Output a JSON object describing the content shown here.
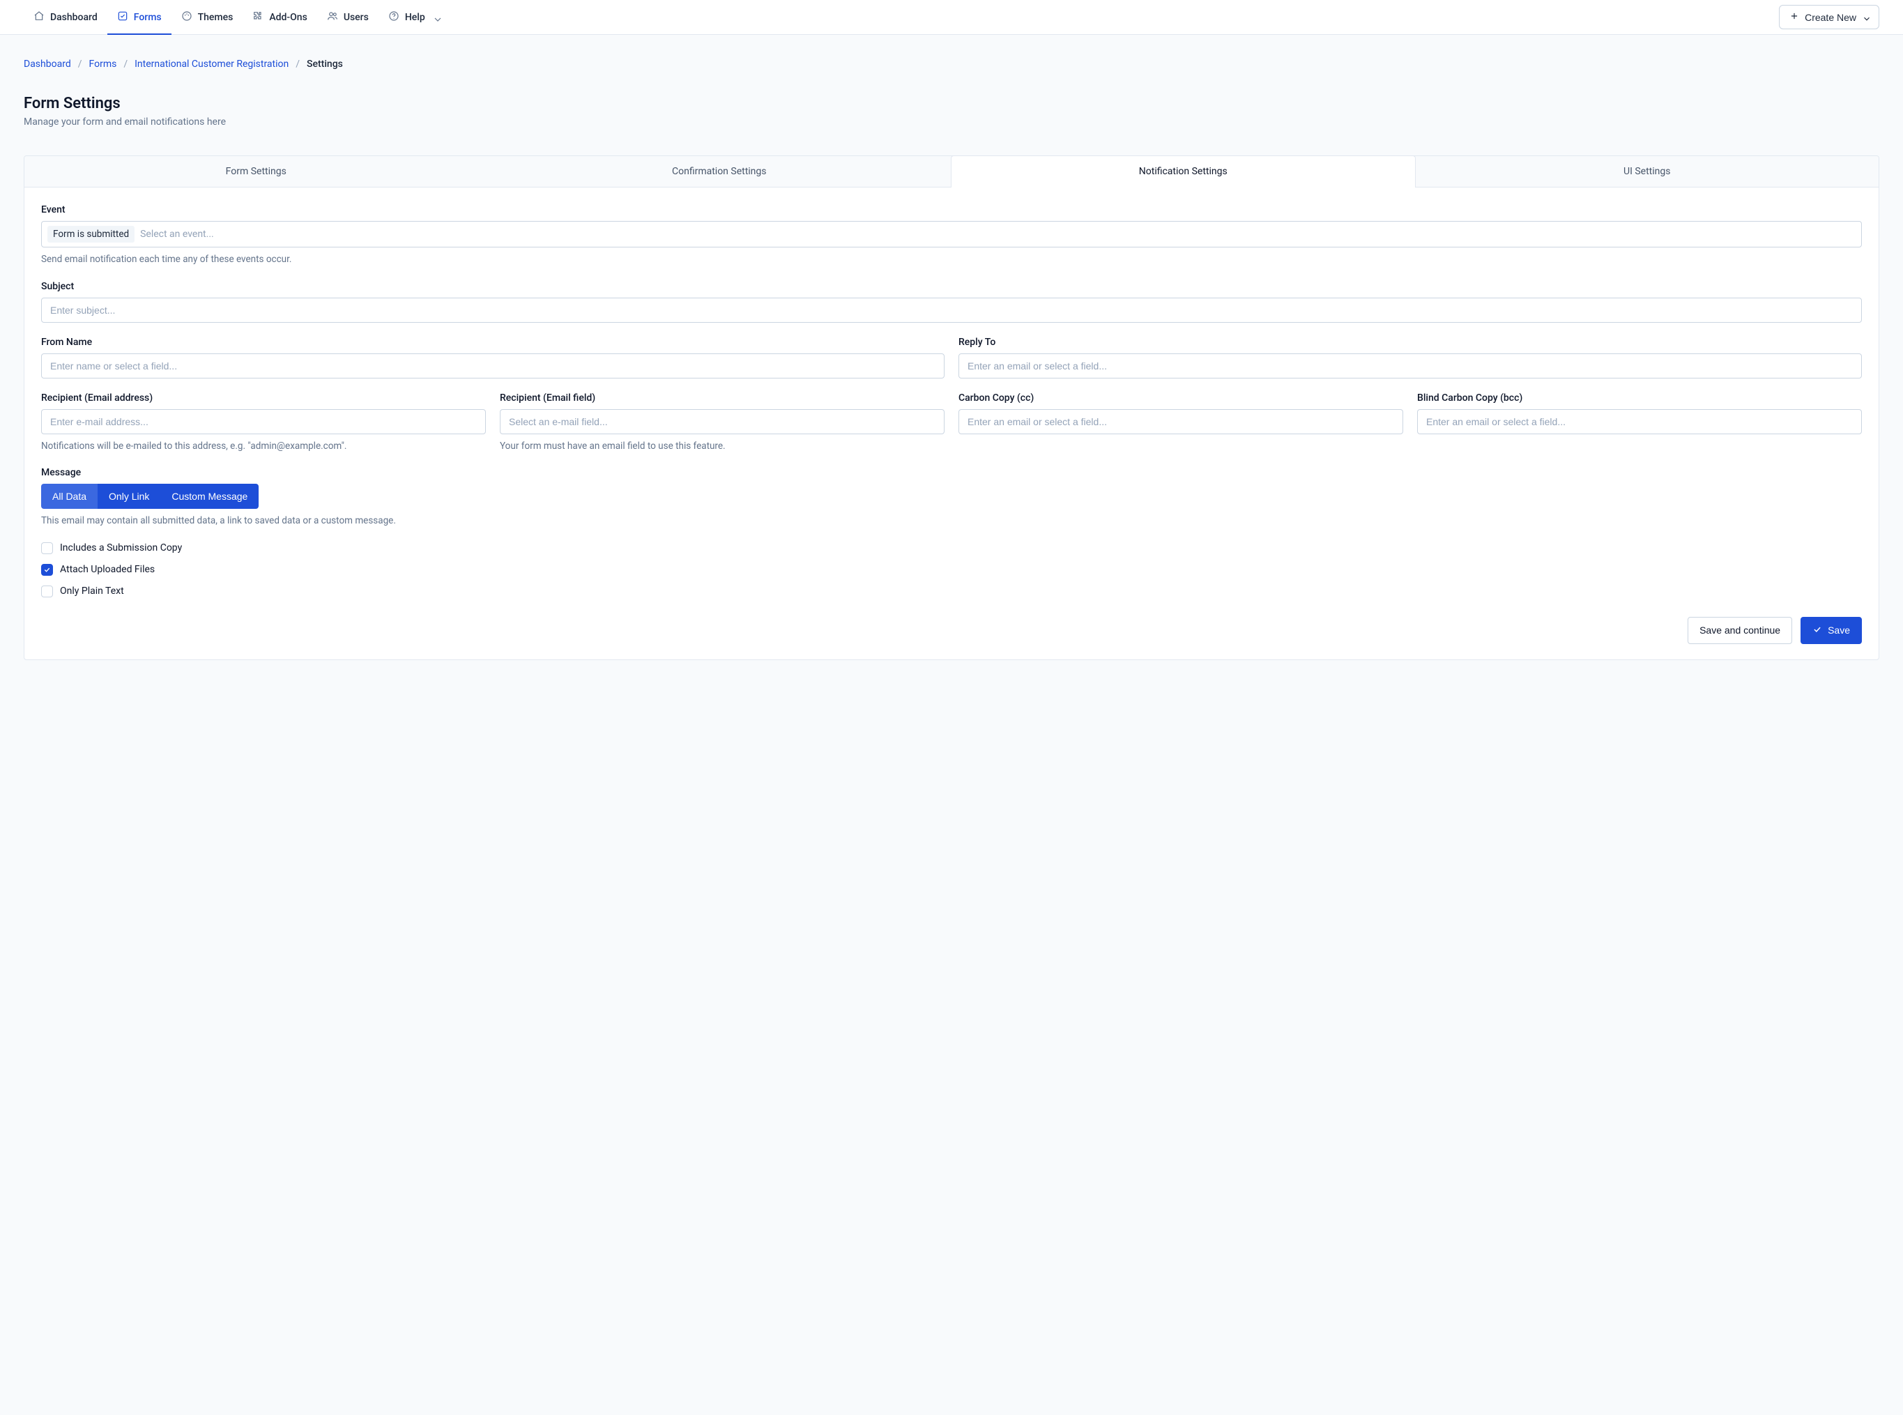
{
  "nav": {
    "items": [
      {
        "id": "dashboard",
        "label": "Dashboard",
        "icon": "home"
      },
      {
        "id": "forms",
        "label": "Forms",
        "icon": "check-square",
        "active": true
      },
      {
        "id": "themes",
        "label": "Themes",
        "icon": "palette"
      },
      {
        "id": "addons",
        "label": "Add-Ons",
        "icon": "puzzle"
      },
      {
        "id": "users",
        "label": "Users",
        "icon": "users"
      },
      {
        "id": "help",
        "label": "Help",
        "icon": "help",
        "dropdown": true
      }
    ],
    "create_label": "Create New"
  },
  "breadcrumb": {
    "items": [
      {
        "label": "Dashboard",
        "link": true
      },
      {
        "label": "Forms",
        "link": true
      },
      {
        "label": "International Customer Registration",
        "link": true
      },
      {
        "label": "Settings",
        "link": false
      }
    ]
  },
  "page": {
    "title": "Form Settings",
    "subtitle": "Manage your form and email notifications here"
  },
  "tabs": {
    "items": [
      {
        "id": "form",
        "label": "Form Settings"
      },
      {
        "id": "confirmation",
        "label": "Confirmation Settings"
      },
      {
        "id": "notification",
        "label": "Notification Settings",
        "active": true
      },
      {
        "id": "ui",
        "label": "UI Settings"
      }
    ]
  },
  "form": {
    "event": {
      "label": "Event",
      "selected_tag": "Form is submitted",
      "placeholder": "Select an event...",
      "hint": "Send email notification each time any of these events occur."
    },
    "subject": {
      "label": "Subject",
      "placeholder": "Enter subject...",
      "value": ""
    },
    "from_name": {
      "label": "From Name",
      "placeholder": "Enter name or select a field...",
      "value": ""
    },
    "reply_to": {
      "label": "Reply To",
      "placeholder": "Enter an email or select a field...",
      "value": ""
    },
    "recipient_address": {
      "label": "Recipient (Email address)",
      "placeholder": "Enter e-mail address...",
      "value": "",
      "hint": "Notifications will be e-mailed to this address, e.g. \"admin@example.com\"."
    },
    "recipient_field": {
      "label": "Recipient (Email field)",
      "placeholder": "Select an e-mail field...",
      "value": "",
      "hint": "Your form must have an email field to use this feature."
    },
    "cc": {
      "label": "Carbon Copy (cc)",
      "placeholder": "Enter an email or select a field...",
      "value": ""
    },
    "bcc": {
      "label": "Blind Carbon Copy (bcc)",
      "placeholder": "Enter an email or select a field...",
      "value": ""
    },
    "message": {
      "label": "Message",
      "options": [
        {
          "id": "all",
          "label": "All Data",
          "active": true
        },
        {
          "id": "link",
          "label": "Only Link"
        },
        {
          "id": "custom",
          "label": "Custom Message"
        }
      ],
      "hint": "This email may contain all submitted data, a link to saved data or a custom message."
    },
    "checks": [
      {
        "id": "submission_copy",
        "label": "Includes a Submission Copy",
        "checked": false
      },
      {
        "id": "attach_files",
        "label": "Attach Uploaded Files",
        "checked": true
      },
      {
        "id": "plain_text",
        "label": "Only Plain Text",
        "checked": false
      }
    ]
  },
  "footer": {
    "save_continue": "Save and continue",
    "save": "Save"
  }
}
